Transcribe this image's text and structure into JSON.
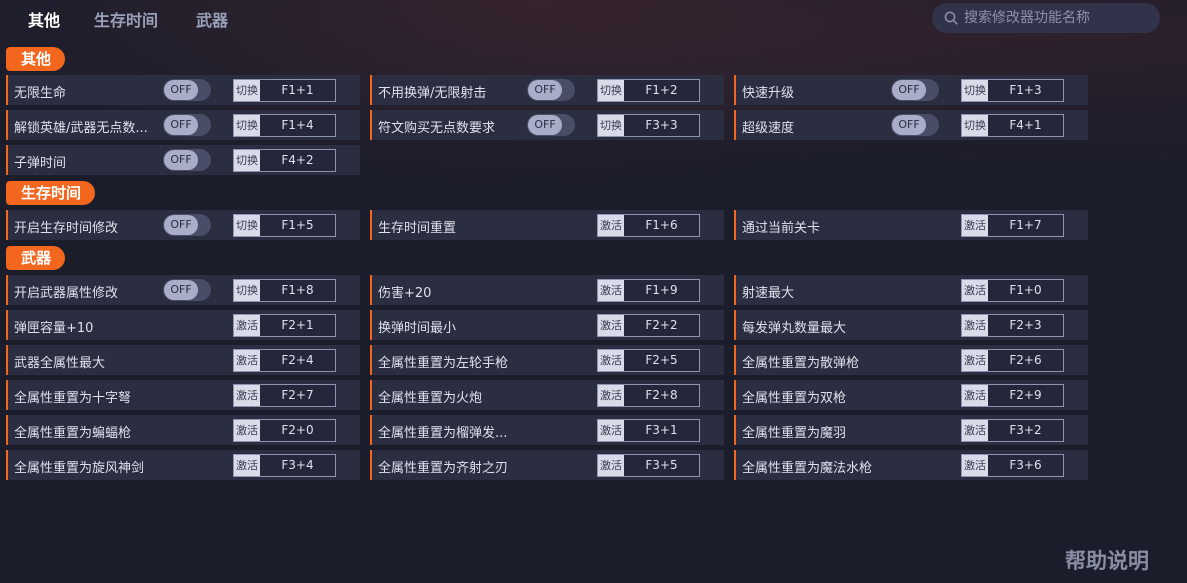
{
  "tabs": [
    {
      "label": "其他",
      "active": true
    },
    {
      "label": "生存时间",
      "active": false
    },
    {
      "label": "武器",
      "active": false
    }
  ],
  "search": {
    "placeholder": "搜索修改器功能名称"
  },
  "help_label": "帮助说明",
  "colors": {
    "accent": "#f2661d",
    "background": "#1c1d2b",
    "row": "#2b2d40"
  },
  "sections": [
    {
      "title": "其他",
      "rows": [
        [
          {
            "label": "无限生命",
            "toggle": "OFF",
            "key_type": "切换",
            "key": "F1+1"
          },
          {
            "label": "不用换弹/无限射击",
            "toggle": "OFF",
            "key_type": "切换",
            "key": "F1+2"
          },
          {
            "label": "快速升级",
            "toggle": "OFF",
            "key_type": "切换",
            "key": "F1+3"
          }
        ],
        [
          {
            "label": "解锁英雄/武器无点数...",
            "toggle": "OFF",
            "key_type": "切换",
            "key": "F1+4"
          },
          {
            "label": "符文购买无点数要求",
            "toggle": "OFF",
            "key_type": "切换",
            "key": "F3+3"
          },
          {
            "label": "超级速度",
            "toggle": "OFF",
            "key_type": "切换",
            "key": "F4+1"
          }
        ],
        [
          {
            "label": "子弹时间",
            "toggle": "OFF",
            "key_type": "切换",
            "key": "F4+2"
          }
        ]
      ]
    },
    {
      "title": "生存时间",
      "rows": [
        [
          {
            "label": "开启生存时间修改",
            "toggle": "OFF",
            "key_type": "切换",
            "key": "F1+5"
          },
          {
            "label": "生存时间重置",
            "key_type": "激活",
            "key": "F1+6"
          },
          {
            "label": "通过当前关卡",
            "key_type": "激活",
            "key": "F1+7"
          }
        ]
      ]
    },
    {
      "title": "武器",
      "rows": [
        [
          {
            "label": "开启武器属性修改",
            "toggle": "OFF",
            "key_type": "切换",
            "key": "F1+8"
          },
          {
            "label": "伤害+20",
            "key_type": "激活",
            "key": "F1+9"
          },
          {
            "label": "射速最大",
            "key_type": "激活",
            "key": "F1+0"
          }
        ],
        [
          {
            "label": "弹匣容量+10",
            "key_type": "激活",
            "key": "F2+1"
          },
          {
            "label": "换弹时间最小",
            "key_type": "激活",
            "key": "F2+2"
          },
          {
            "label": "每发弹丸数量最大",
            "key_type": "激活",
            "key": "F2+3"
          }
        ],
        [
          {
            "label": "武器全属性最大",
            "key_type": "激活",
            "key": "F2+4"
          },
          {
            "label": "全属性重置为左轮手枪",
            "key_type": "激活",
            "key": "F2+5"
          },
          {
            "label": "全属性重置为散弹枪",
            "key_type": "激活",
            "key": "F2+6"
          }
        ],
        [
          {
            "label": "全属性重置为十字弩",
            "key_type": "激活",
            "key": "F2+7"
          },
          {
            "label": "全属性重置为火炮",
            "key_type": "激活",
            "key": "F2+8"
          },
          {
            "label": "全属性重置为双枪",
            "key_type": "激活",
            "key": "F2+9"
          }
        ],
        [
          {
            "label": "全属性重置为蝙蝠枪",
            "key_type": "激活",
            "key": "F2+0"
          },
          {
            "label": "全属性重置为榴弹发...",
            "key_type": "激活",
            "key": "F3+1"
          },
          {
            "label": "全属性重置为魔羽",
            "key_type": "激活",
            "key": "F3+2"
          }
        ],
        [
          {
            "label": "全属性重置为旋风神剑",
            "key_type": "激活",
            "key": "F3+4"
          },
          {
            "label": "全属性重置为齐射之刃",
            "key_type": "激活",
            "key": "F3+5"
          },
          {
            "label": "全属性重置为魔法水枪",
            "key_type": "激活",
            "key": "F3+6"
          }
        ]
      ]
    }
  ]
}
